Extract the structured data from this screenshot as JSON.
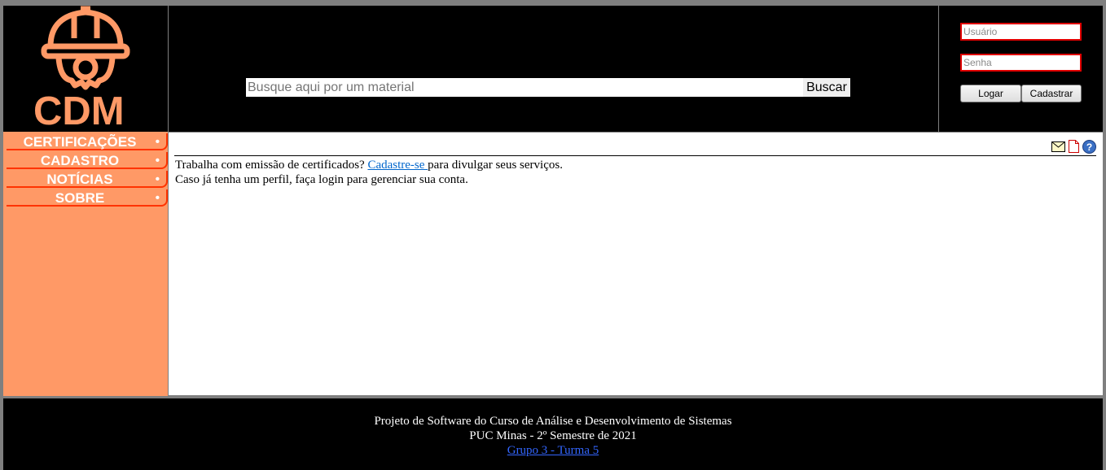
{
  "header": {
    "logo_text": "CDM",
    "search": {
      "placeholder": "Busque aqui por um material",
      "value": "",
      "button_label": "Buscar"
    },
    "login": {
      "username_placeholder": "Usuário",
      "password_placeholder": "Senha",
      "login_label": "Logar",
      "register_label": "Cadastrar"
    }
  },
  "sidebar": {
    "items": [
      {
        "label": "CERTIFICAÇÕES",
        "bullet": "•"
      },
      {
        "label": "CADASTRO",
        "bullet": "•"
      },
      {
        "label": "NOTÍCIAS",
        "bullet": "•"
      },
      {
        "label": "SOBRE",
        "bullet": "•"
      }
    ]
  },
  "content": {
    "icons": [
      "mail-icon",
      "document-icon",
      "help-icon"
    ],
    "line1_before": "Trabalha com emissão de certificados? ",
    "line1_link": "Cadastre-se ",
    "line1_after": "para divulgar seus serviços.",
    "line2": "Caso já tenha um perfil, faça login para gerenciar sua conta."
  },
  "footer": {
    "line1": "Projeto de Software do Curso de Análise e Desenvolvimento de Sistemas",
    "line2": "PUC Minas - 2º Semestre de 2021",
    "link": "Grupo 3 - Turma 5"
  },
  "colors": {
    "accent": "#ff9966",
    "accent_border": "#ff3300",
    "header_bg": "#000000",
    "link": "#0066cc"
  }
}
